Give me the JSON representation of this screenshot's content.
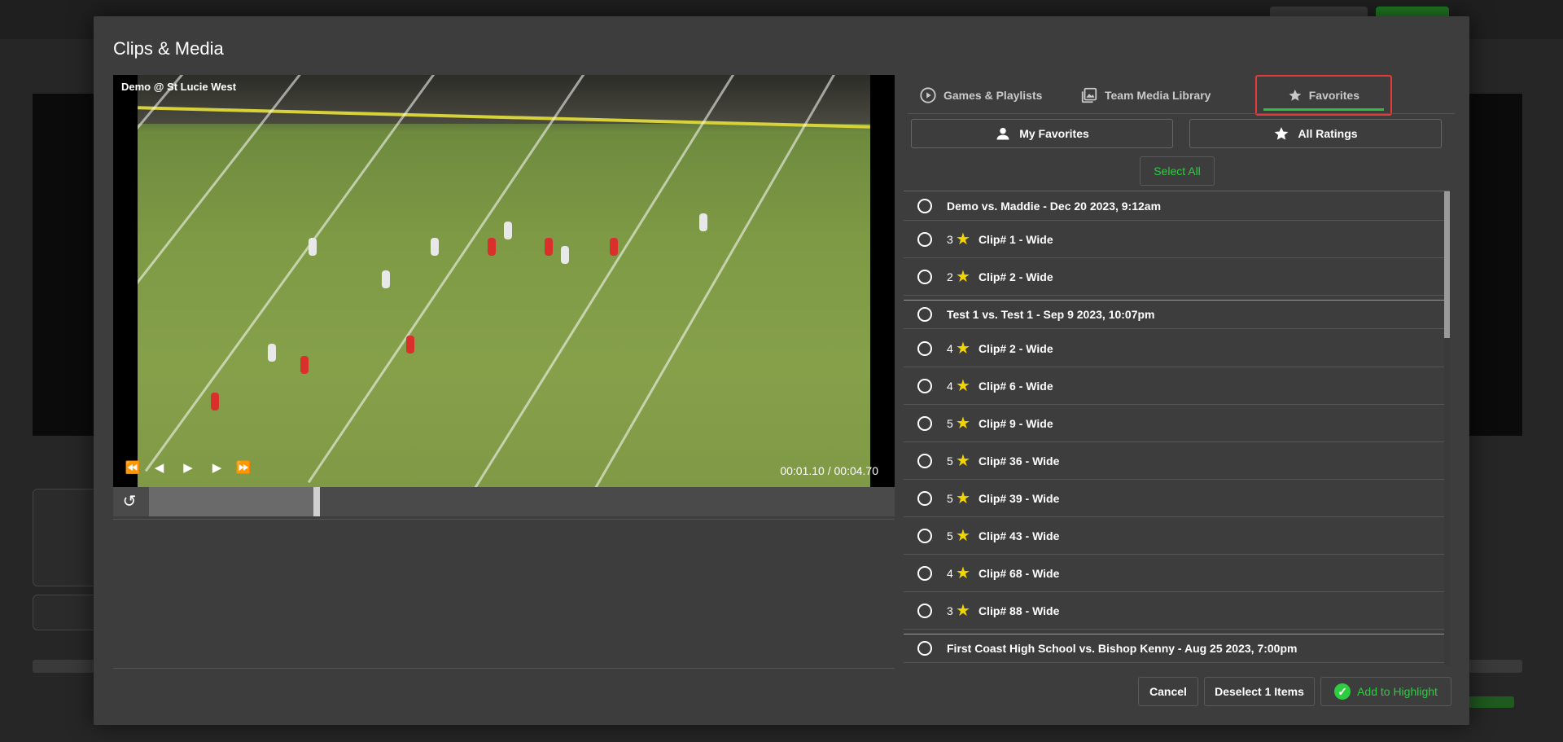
{
  "modal": {
    "title": "Clips & Media"
  },
  "video": {
    "label": "Demo @ St Lucie West",
    "time": "00:01.10 / 00:04.70",
    "progress": 0.23
  },
  "tabs": [
    {
      "label": "Games & Playlists",
      "icon": "play-circle-icon"
    },
    {
      "label": "Team Media Library",
      "icon": "media-library-icon"
    },
    {
      "label": "Favorites",
      "icon": "star-icon",
      "active": true
    }
  ],
  "filters": {
    "my_favorites": "My Favorites",
    "all_ratings": "All Ratings",
    "select_all": "Select All"
  },
  "list": {
    "groups": [
      {
        "title": "Demo vs. Maddie - Dec 20 2023, 9:12am",
        "items": [
          {
            "rating": "3",
            "label": "Clip# 1 - Wide"
          },
          {
            "rating": "2",
            "label": "Clip# 2 - Wide"
          }
        ]
      },
      {
        "title": "Test 1 vs. Test 1 - Sep 9 2023, 10:07pm",
        "items": [
          {
            "rating": "4",
            "label": "Clip# 2 - Wide"
          },
          {
            "rating": "4",
            "label": "Clip# 6 - Wide"
          },
          {
            "rating": "5",
            "label": "Clip# 9 - Wide"
          },
          {
            "rating": "5",
            "label": "Clip# 36 - Wide"
          },
          {
            "rating": "5",
            "label": "Clip# 39 - Wide"
          },
          {
            "rating": "5",
            "label": "Clip# 43 - Wide"
          },
          {
            "rating": "4",
            "label": "Clip# 68 - Wide"
          },
          {
            "rating": "3",
            "label": "Clip# 88 - Wide"
          }
        ]
      },
      {
        "title": "First Coast High School vs. Bishop Kenny - Aug 25 2023, 7:00pm",
        "items": []
      }
    ]
  },
  "footer": {
    "cancel": "Cancel",
    "deselect": "Deselect 1 Items",
    "add": "Add to Highlight"
  },
  "colors": {
    "accent_green": "#2ecc40",
    "active_tab_border": "#e43a3a",
    "star": "#f1d500"
  }
}
